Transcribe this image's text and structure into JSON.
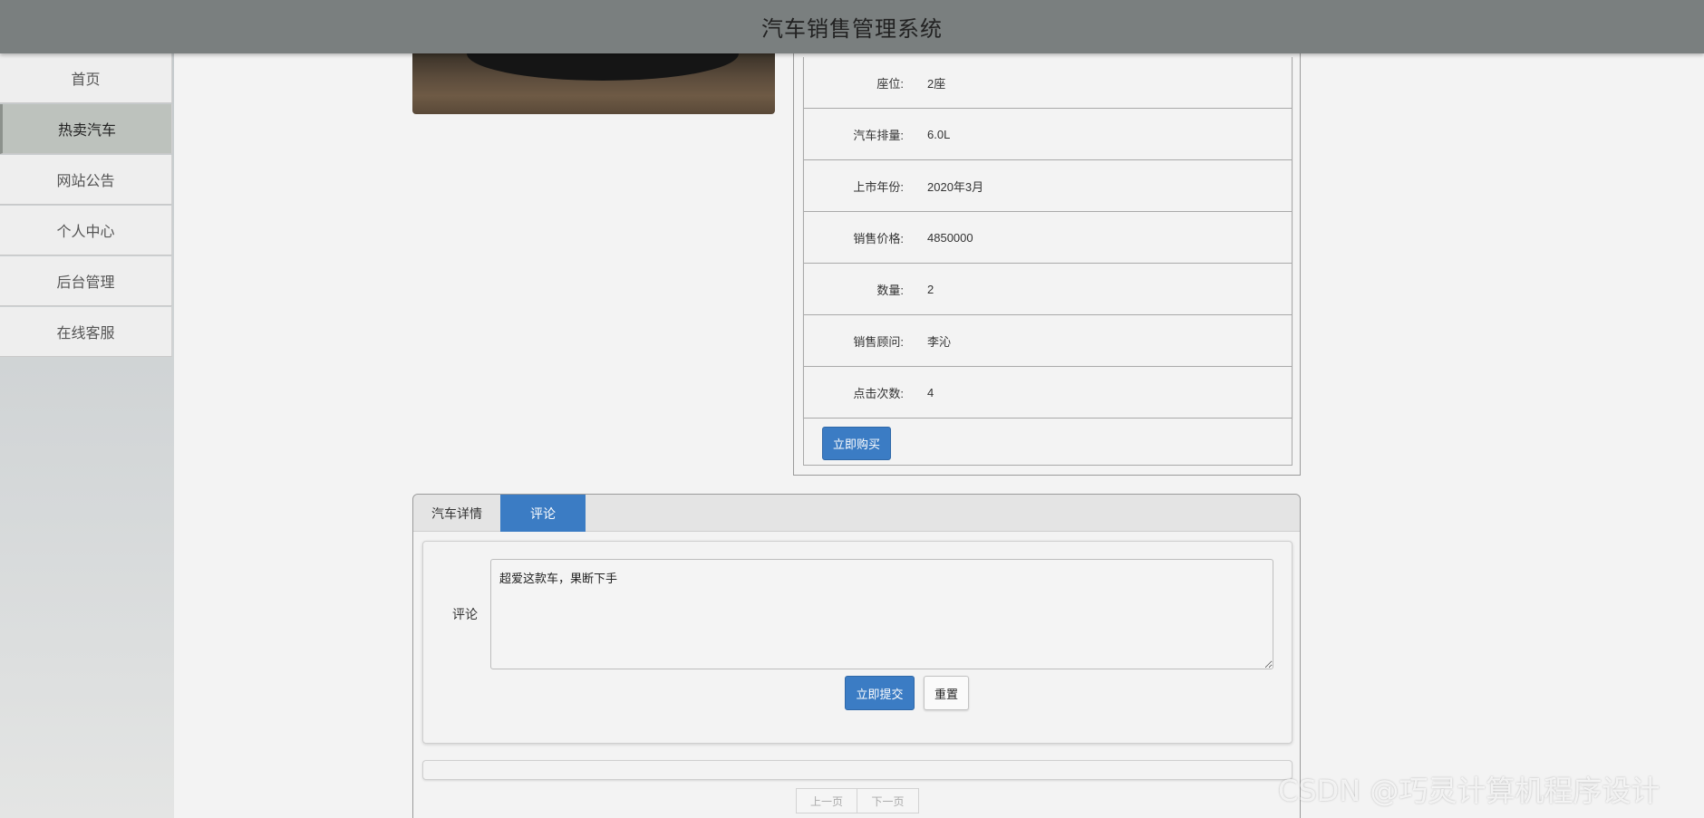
{
  "header": {
    "title": "汽车销售管理系统"
  },
  "sidebar": {
    "items": [
      {
        "label": "首页"
      },
      {
        "label": "热卖汽车"
      },
      {
        "label": "网站公告"
      },
      {
        "label": "个人中心"
      },
      {
        "label": "后台管理"
      },
      {
        "label": "在线客服"
      }
    ],
    "active_index": 1
  },
  "car_info": {
    "rows": [
      {
        "label": "座位:",
        "value": "2座"
      },
      {
        "label": "汽车排量:",
        "value": "6.0L"
      },
      {
        "label": "上市年份:",
        "value": "2020年3月"
      },
      {
        "label": "销售价格:",
        "value": "4850000"
      },
      {
        "label": "数量:",
        "value": "2"
      },
      {
        "label": "销售顾问:",
        "value": "李沁"
      },
      {
        "label": "点击次数:",
        "value": "4"
      }
    ],
    "buy_label": "立即购买"
  },
  "tabs": {
    "items": [
      {
        "label": "汽车详情"
      },
      {
        "label": "评论"
      }
    ],
    "active_index": 1
  },
  "comment_form": {
    "label": "评论",
    "value": "超爱这款车，果断下手",
    "submit_label": "立即提交",
    "reset_label": "重置"
  },
  "pagination": {
    "prev_label": "上一页",
    "next_label": "下一页"
  },
  "watermark": "CSDN @巧灵计算机程序设计",
  "colors": {
    "header_bg": "#7a7f7f",
    "primary": "#3b7cc4",
    "active_nav_bg": "#bdc2bd"
  }
}
